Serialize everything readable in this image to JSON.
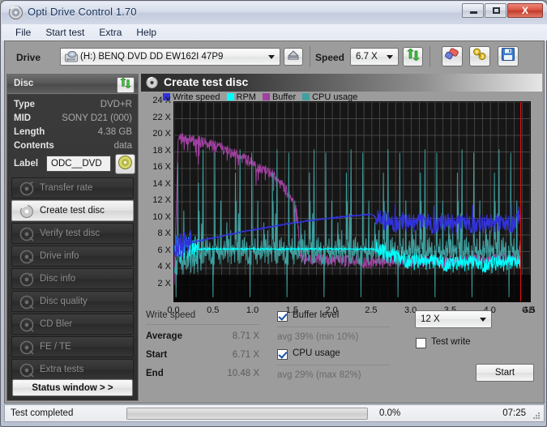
{
  "window": {
    "title": "Opti Drive Control 1.70",
    "icon": "disc-icon",
    "buttons": {
      "minimize": "minimize-icon",
      "maximize": "maximize-icon",
      "close": "X"
    }
  },
  "menu": {
    "items": [
      "File",
      "Start test",
      "Extra",
      "Help"
    ]
  },
  "toolbar": {
    "drive_label": "Drive",
    "drive_value": "(H:)   BENQ DVD DD EW162I 47P9",
    "eject_icon": "eject-icon",
    "speed_label": "Speed",
    "speed_value": "6.7 X",
    "refresh_icon": "refresh-icon",
    "eraser_icon": "eraser-icon",
    "tools_icon": "tools-icon",
    "save_icon": "save-icon"
  },
  "disc": {
    "header": "Disc",
    "refresh_icon": "refresh-icon",
    "rows": [
      {
        "key": "Type",
        "value": "DVD+R"
      },
      {
        "key": "MID",
        "value": "SONY D21 (000)"
      },
      {
        "key": "Length",
        "value": "4.38 GB"
      },
      {
        "key": "Contents",
        "value": "data"
      }
    ],
    "label_key": "Label",
    "label_value": "ODC__DVD",
    "disc_icon": "cd-disc-icon"
  },
  "nav": {
    "items": [
      {
        "label": "Transfer rate",
        "selected": false,
        "icon": "disc-scan-icon"
      },
      {
        "label": "Create test disc",
        "selected": true,
        "icon": "disc-write-icon"
      },
      {
        "label": "Verify test disc",
        "selected": false,
        "icon": "disc-check-icon"
      },
      {
        "label": "Drive info",
        "selected": false,
        "icon": "disc-info-icon"
      },
      {
        "label": "Disc info",
        "selected": false,
        "icon": "disc-info-icon"
      },
      {
        "label": "Disc quality",
        "selected": false,
        "icon": "disc-quality-icon"
      },
      {
        "label": "CD Bler",
        "selected": false,
        "icon": "disc-bler-icon"
      },
      {
        "label": "FE / TE",
        "selected": false,
        "icon": "disc-fete-icon"
      },
      {
        "label": "Extra tests",
        "selected": false,
        "icon": "disc-extra-icon"
      }
    ],
    "status_window": "Status window > >"
  },
  "panel": {
    "title": "Create test disc",
    "icon": "disc-write-icon"
  },
  "chart_data": {
    "type": "line",
    "title": "Create test disc",
    "xlabel": "GB",
    "ylabel": "X",
    "xlim": [
      0.0,
      4.5
    ],
    "ylim": [
      0,
      24
    ],
    "grid": true,
    "legend_position": "top-left",
    "x_ticks": [
      "0.0",
      "0.5",
      "1.0",
      "1.5",
      "2.0",
      "2.5",
      "3.0",
      "3.5",
      "4.0",
      "4.5"
    ],
    "x_unit": "GB",
    "y_ticks": [
      "2 X",
      "4 X",
      "6 X",
      "8 X",
      "10 X",
      "12 X",
      "14 X",
      "16 X",
      "18 X",
      "20 X",
      "22 X",
      "24 X"
    ],
    "marker_line": {
      "value": 4.38,
      "color": "#e01010"
    },
    "series": [
      {
        "name": "Write speed",
        "color": "#3232dc",
        "note": "CAV ramp 6.7X -> 10.5X then noisy plateau",
        "x": [
          0.0,
          0.1,
          0.2,
          0.3,
          0.4,
          0.5,
          0.6,
          0.7,
          0.8,
          0.9,
          1.0,
          1.1,
          1.2,
          1.3,
          1.4,
          1.5,
          1.6,
          1.7,
          1.8,
          1.9,
          2.0,
          2.1,
          2.2,
          2.3,
          2.4,
          2.5,
          2.6,
          2.7,
          2.8,
          2.9,
          3.0,
          3.1,
          3.2,
          3.3,
          3.4,
          3.5,
          3.6,
          3.7,
          3.8,
          3.9,
          4.0,
          4.1,
          4.2,
          4.3,
          4.38
        ],
        "y": [
          6.71,
          6.85,
          7.05,
          7.25,
          7.45,
          7.65,
          7.85,
          8.05,
          8.25,
          8.45,
          8.62,
          8.78,
          8.95,
          9.12,
          9.28,
          9.42,
          9.56,
          9.7,
          9.82,
          9.94,
          10.05,
          10.15,
          10.25,
          10.33,
          10.4,
          10.46,
          9.8,
          9.6,
          9.45,
          9.55,
          9.3,
          9.6,
          9.4,
          9.25,
          9.5,
          9.35,
          9.2,
          9.45,
          9.3,
          9.15,
          9.4,
          9.25,
          9.35,
          9.5,
          10.48
        ]
      },
      {
        "name": "RPM",
        "color": "#00ffff",
        "note": "flat near 6.3X equivalent, becomes noisy after ~2.6 GB",
        "x": [
          0.0,
          0.25,
          0.5,
          0.75,
          1.0,
          1.25,
          1.5,
          1.75,
          2.0,
          2.25,
          2.5,
          2.6,
          2.75,
          3.0,
          3.25,
          3.5,
          3.75,
          4.0,
          4.25,
          4.38
        ],
        "y": [
          6.3,
          6.3,
          6.3,
          6.3,
          6.3,
          6.3,
          6.3,
          6.3,
          6.3,
          6.3,
          6.3,
          6.1,
          5.4,
          4.9,
          4.7,
          4.6,
          4.55,
          4.5,
          4.6,
          4.7
        ]
      },
      {
        "name": "Buffer",
        "color": "#a040a0",
        "note": "buffer level ~19-20X scale early, drops to ~5X after 1.6 GB",
        "x": [
          0.0,
          0.05,
          0.15,
          0.3,
          0.45,
          0.6,
          0.75,
          0.9,
          1.05,
          1.2,
          1.3,
          1.4,
          1.5,
          1.55,
          1.6,
          1.75,
          2.0,
          2.25,
          2.5,
          2.75,
          3.0,
          3.25,
          3.5,
          3.75,
          4.0,
          4.25,
          4.38
        ],
        "y": [
          2.0,
          19.6,
          19.4,
          19.2,
          18.8,
          18.4,
          17.6,
          17.0,
          16.2,
          15.4,
          14.6,
          13.4,
          12.0,
          11.0,
          5.2,
          5.0,
          4.9,
          4.8,
          4.7,
          4.8,
          4.7,
          4.9,
          4.8,
          4.9,
          5.0,
          5.1,
          5.0
        ]
      },
      {
        "name": "CPU usage",
        "color": "#40a0a0",
        "note": "noisy spikes, avg 29% max 82%",
        "x": [
          0.0,
          0.2,
          0.4,
          0.6,
          0.8,
          1.0,
          1.2,
          1.4,
          1.6,
          1.8,
          2.0,
          2.2,
          2.4,
          2.6,
          2.8,
          3.0,
          3.2,
          3.4,
          3.6,
          3.8,
          4.0,
          4.2,
          4.38
        ],
        "y": [
          3.2,
          5.8,
          8.4,
          4.6,
          11.6,
          6.2,
          7.8,
          13.2,
          5.4,
          9.6,
          6.8,
          12.4,
          7.2,
          14.8,
          6.6,
          8.4,
          15.2,
          7.6,
          9.8,
          6.4,
          11.8,
          16.4,
          8.2
        ]
      }
    ],
    "legend": [
      {
        "label": "Write speed",
        "color": "#3232dc"
      },
      {
        "label": "RPM",
        "color": "#00ffff"
      },
      {
        "label": "Buffer",
        "color": "#a040a0"
      },
      {
        "label": "CPU usage",
        "color": "#40a0a0"
      }
    ]
  },
  "stats": {
    "write_speed_title": "Write speed",
    "rows": [
      {
        "key": "Average",
        "value": "8.71 X"
      },
      {
        "key": "Start",
        "value": "6.71 X"
      },
      {
        "key": "End",
        "value": "10.48 X"
      }
    ],
    "buffer_level_label": "Buffer level",
    "buffer_level_checked": true,
    "buffer_note": "avg 39% (min 10%)",
    "cpu_usage_label": "CPU usage",
    "cpu_usage_checked": true,
    "cpu_note": "avg 29% (max 82%)",
    "speed_select_value": "12 X",
    "test_write_label": "Test write",
    "test_write_checked": false,
    "start_button": "Start"
  },
  "statusbar": {
    "message": "Test completed",
    "progress_text": "0.0%",
    "progress_value": 0,
    "time": "07:25"
  }
}
